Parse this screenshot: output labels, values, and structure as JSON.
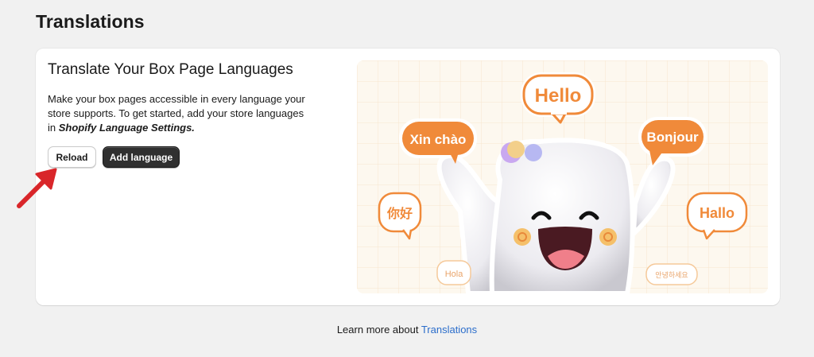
{
  "page": {
    "title": "Translations"
  },
  "card": {
    "title": "Translate Your Box Page Languages",
    "description_lead": "Make your box pages accessible in every language your store supports. To get started, add your store languages in ",
    "description_bold": "Shopify Language Settings.",
    "reload_label": "Reload",
    "add_language_label": "Add language"
  },
  "illustration": {
    "greetings": {
      "hello": "Hello",
      "xin_chao": "Xin chào",
      "bonjour": "Bonjour",
      "nihao": "你好",
      "hallo": "Hallo",
      "hola": "Hola",
      "korean": "안녕하세요"
    }
  },
  "footer": {
    "lead": "Learn more about ",
    "link": "Translations"
  },
  "colors": {
    "accent_orange": "#f08a3a",
    "link_blue": "#2c6ecb",
    "primary_button": "#303030",
    "annotation_arrow": "#d9262a"
  }
}
